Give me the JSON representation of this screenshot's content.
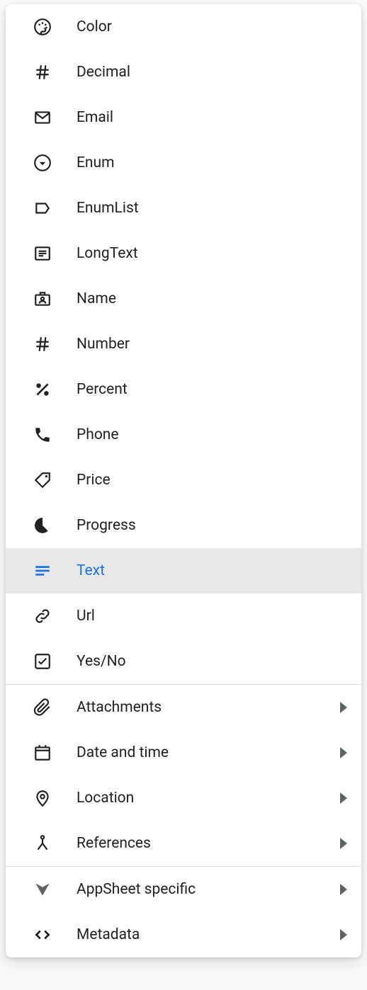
{
  "colors": {
    "selected_bg": "#e8e8e8",
    "selected_fg": "#1a73e8",
    "text": "#202124",
    "divider": "#dadce0"
  },
  "menu": {
    "selected": "text",
    "items": [
      {
        "id": "color",
        "label": "Color",
        "icon": "palette",
        "submenu": false
      },
      {
        "id": "decimal",
        "label": "Decimal",
        "icon": "hash",
        "submenu": false
      },
      {
        "id": "email",
        "label": "Email",
        "icon": "mail",
        "submenu": false
      },
      {
        "id": "enum",
        "label": "Enum",
        "icon": "circle-dot",
        "submenu": false
      },
      {
        "id": "enumlist",
        "label": "EnumList",
        "icon": "tag-outline",
        "submenu": false
      },
      {
        "id": "longtext",
        "label": "LongText",
        "icon": "textbox",
        "submenu": false
      },
      {
        "id": "name",
        "label": "Name",
        "icon": "badge",
        "submenu": false
      },
      {
        "id": "number",
        "label": "Number",
        "icon": "hash",
        "submenu": false
      },
      {
        "id": "percent",
        "label": "Percent",
        "icon": "percent",
        "submenu": false
      },
      {
        "id": "phone",
        "label": "Phone",
        "icon": "phone",
        "submenu": false
      },
      {
        "id": "price",
        "label": "Price",
        "icon": "pricetag",
        "submenu": false
      },
      {
        "id": "progress",
        "label": "Progress",
        "icon": "pie",
        "submenu": false
      },
      {
        "id": "text",
        "label": "Text",
        "icon": "notes",
        "submenu": false
      },
      {
        "id": "url",
        "label": "Url",
        "icon": "link",
        "submenu": false
      },
      {
        "id": "yesno",
        "label": "Yes/No",
        "icon": "checkbox",
        "submenu": false
      }
    ],
    "groups": [
      {
        "id": "attachments",
        "label": "Attachments",
        "icon": "attachment",
        "submenu": true
      },
      {
        "id": "datetime",
        "label": "Date and time",
        "icon": "calendar",
        "submenu": true
      },
      {
        "id": "location",
        "label": "Location",
        "icon": "pin",
        "submenu": true
      },
      {
        "id": "references",
        "label": "References",
        "icon": "merge",
        "submenu": true
      }
    ],
    "advanced": [
      {
        "id": "appsheet",
        "label": "AppSheet specific",
        "icon": "appsheet",
        "submenu": true
      },
      {
        "id": "metadata",
        "label": "Metadata",
        "icon": "code",
        "submenu": true
      }
    ]
  }
}
